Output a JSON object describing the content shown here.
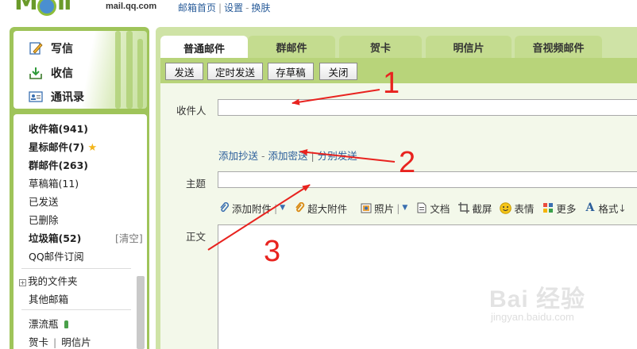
{
  "header": {
    "logo_domain": "mail.qq.com",
    "links": [
      "邮箱首页",
      "设置",
      "换肤"
    ]
  },
  "sidebar": {
    "actions": [
      {
        "label": "写信",
        "icon": "pencil-paper-icon"
      },
      {
        "label": "收信",
        "icon": "inbox-download-icon"
      },
      {
        "label": "通讯录",
        "icon": "address-card-icon"
      }
    ],
    "folders": [
      {
        "label": "收件箱(941)",
        "bold": true
      },
      {
        "label": "星标邮件(7)",
        "bold": true,
        "icon": "star-icon"
      },
      {
        "label": "群邮件(263)",
        "bold": true
      },
      {
        "label": "草稿箱(11)",
        "bold": false
      },
      {
        "label": "已发送",
        "bold": false
      },
      {
        "label": "已删除",
        "bold": false
      },
      {
        "label": "垃圾箱(52)",
        "bold": true,
        "extra": "[清空]"
      },
      {
        "label": "QQ邮件订阅",
        "bold": false
      }
    ],
    "my_folders": "我的文件夹",
    "other_mailbox": "其他邮箱",
    "drift_bottle": "漂流瓶",
    "cards": "贺卡",
    "postcards": "明信片"
  },
  "tabs": [
    {
      "label": "普通邮件",
      "active": true
    },
    {
      "label": "群邮件",
      "active": false
    },
    {
      "label": "贺卡",
      "active": false
    },
    {
      "label": "明信片",
      "active": false
    },
    {
      "label": "音视频邮件",
      "active": false
    }
  ],
  "toolbar": {
    "send": "发送",
    "scheduled_send": "定时发送",
    "save_draft": "存草稿",
    "close": "关闭"
  },
  "form": {
    "to_label": "收件人",
    "to_value": "",
    "cc_links": [
      "添加抄送",
      "添加密送",
      "分别发送"
    ],
    "subject_label": "主题",
    "subject_value": "",
    "body_label": "正文",
    "attach_items": [
      {
        "label": "添加附件",
        "icon": "paperclip-icon"
      },
      {
        "label": "超大附件",
        "icon": "large-paperclip-icon"
      },
      {
        "label": "照片",
        "icon": "photo-icon"
      },
      {
        "label": "文档",
        "icon": "document-icon"
      },
      {
        "label": "截屏",
        "icon": "screenshot-icon"
      },
      {
        "label": "表情",
        "icon": "smiley-icon"
      },
      {
        "label": "更多",
        "icon": "more-grid-icon"
      },
      {
        "label": "格式",
        "icon": "format-text-icon"
      }
    ]
  },
  "annotations": {
    "numbers": [
      "1",
      "2",
      "3"
    ],
    "color": "#e8231f"
  },
  "watermark": {
    "brand": "Bai 经验",
    "url": "jingyan.baidu.com"
  },
  "colors": {
    "sidebar_green": "#9fc45a",
    "tab_green": "#c4dc8f",
    "link_blue": "#2a5d9a"
  }
}
